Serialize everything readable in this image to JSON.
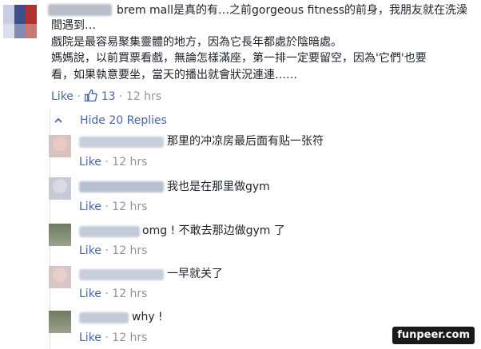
{
  "main_comment": {
    "lines": [
      "brem mall是真的有…之前gorgeous fitness的前身，我朋友就在洗澡",
      "間遇到…",
      "戲院是最容易聚集靈體的地方，因為它長年都處於陰暗處。",
      "媽媽說，以前買票看戲，無論怎樣滿座，第一排一定要留空，因為'它們'也要",
      "看，如果執意要坐，當天的播出就會狀況連連……"
    ],
    "like_label": "Like",
    "separator": "·",
    "like_count": "13",
    "time": "12 hrs"
  },
  "replies_toggle": {
    "label": "Hide 20 Replies"
  },
  "replies": [
    {
      "text": "那里的冲凉房最后面有贴一张符",
      "like_label": "Like",
      "separator": "·",
      "time": "12 hrs"
    },
    {
      "text": "我也是在那里做gym",
      "like_label": "Like",
      "separator": "·",
      "time": "12 hrs"
    },
    {
      "text": "omg ! 不敢去那边做gym 了",
      "like_label": "Like",
      "separator": "·",
      "time": "12 hrs"
    },
    {
      "text": "一早就关了",
      "like_label": "Like",
      "separator": "·",
      "time": "12 hrs"
    },
    {
      "text": "why !",
      "like_label": "Like",
      "separator": "·",
      "time": "12 hrs"
    }
  ],
  "watermark": "funpeer.com",
  "colors": {
    "link": "#4b67a1",
    "meta": "#90949c",
    "text": "#1d2129",
    "rail": "#dddfe2"
  },
  "icons": {
    "like_count_icon": "thumbs-up-icon",
    "toggle_icon": "chevron-up-icon"
  }
}
